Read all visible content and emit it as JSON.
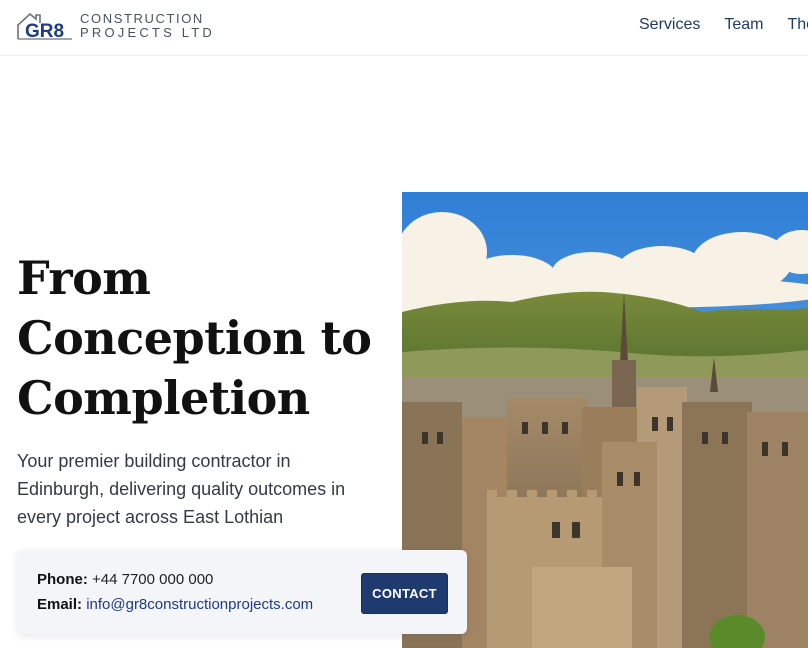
{
  "header": {
    "logo_mark": "GR8",
    "logo_line1": "CONSTRUCTION",
    "logo_line2": "PROJECTS LTD",
    "nav": [
      "Services",
      "Team",
      "The"
    ]
  },
  "hero": {
    "title_lines": [
      "From",
      "Conception to",
      "Completion"
    ],
    "subtitle": "Your premier building contractor in Edinburgh, delivering quality outcomes in every project across East Lothian"
  },
  "contact": {
    "phone_label": "Phone:",
    "phone": "+44 7700 000 000",
    "email_label": "Email:",
    "email": "info@gr8constructionprojects.com",
    "button": "CONTACT"
  },
  "colors": {
    "brand_navy": "#1e3a6e",
    "nav_text": "#1f3a6b"
  },
  "icons": {
    "logo": "house-roof-logo-icon"
  }
}
